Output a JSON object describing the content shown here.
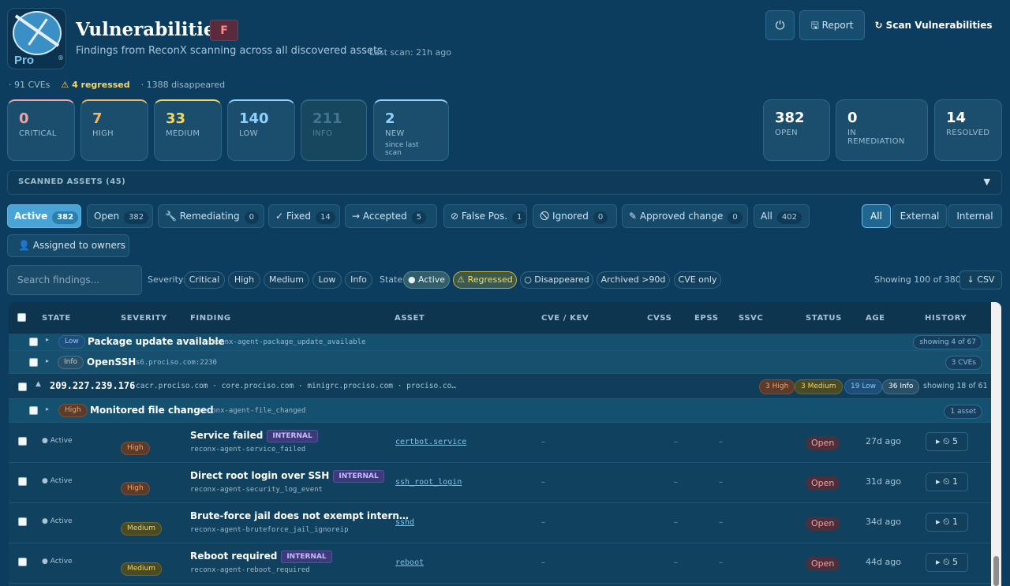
{
  "header": {
    "logo_text": "Pro CISO",
    "logo_sup": "®",
    "title": "Vulnerabilities",
    "grade": "F",
    "subtitle": "Findings from ReconX scanning across all discovered assets",
    "last_scan": "· Last scan: 21h ago",
    "power_icon": "⏻",
    "report_label": "🖫 Report",
    "scan_label": "↻ Scan Vulnerabilities"
  },
  "meta": {
    "cves": "· 91 CVEs",
    "regressed": "⚠ 4 regressed",
    "disappeared": "· 1388 disappeared"
  },
  "stats": [
    {
      "value": "0",
      "label": "CRITICAL",
      "color": "#f2a0a6"
    },
    {
      "value": "7",
      "label": "HIGH",
      "color": "#f2b66b"
    },
    {
      "value": "33",
      "label": "MEDIUM",
      "color": "#f0d868"
    },
    {
      "value": "140",
      "label": "LOW",
      "color": "#8fd0ff"
    },
    {
      "value": "211",
      "label": "INFO",
      "color": "#3f7692"
    },
    {
      "value": "2",
      "label": "NEW",
      "sub": "since last scan",
      "color": "#8fd0ff"
    }
  ],
  "stats_right": [
    {
      "value": "382",
      "label": "OPEN"
    },
    {
      "value": "0",
      "label": "IN REMEDIATION"
    },
    {
      "value": "14",
      "label": "RESOLVED"
    }
  ],
  "assets_bar": {
    "label": "SCANNED ASSETS (45)",
    "chevron": "▼"
  },
  "tabs": [
    {
      "label": "Active",
      "count": "382"
    },
    {
      "label": "Open",
      "count": "382"
    },
    {
      "label": "🔧 Remediating",
      "count": "0"
    },
    {
      "label": "✓ Fixed",
      "count": "14"
    },
    {
      "label": "→ Accepted",
      "count": "5"
    },
    {
      "label": "⊘ False Pos.",
      "count": "1"
    },
    {
      "label": "🛇 Ignored",
      "count": "0"
    },
    {
      "label": "✎ Approved change",
      "count": "0"
    },
    {
      "label": "All",
      "count": "402"
    }
  ],
  "scope": [
    "All",
    "External",
    "Internal"
  ],
  "assigned_label": "👤 Assigned to owners",
  "filters": {
    "search_placeholder": "Search findings...",
    "severity_label": "Severity:",
    "severity": [
      "Critical",
      "High",
      "Medium",
      "Low",
      "Info"
    ],
    "state_label": "State:",
    "states": [
      "● Active",
      "⚠ Regressed",
      "○ Disappeared",
      "Archived >90d",
      "CVE only"
    ],
    "showing": "Showing 100 of 380",
    "csv": "↓ CSV"
  },
  "table": {
    "columns": [
      "STATE",
      "SEVERITY",
      "FINDING",
      "ASSET",
      "CVE / KEV",
      "CVSS",
      "EPSS",
      "SSVC",
      "STATUS",
      "AGE",
      "HISTORY"
    ],
    "group1": {
      "sev": "Low",
      "name": "Package update available",
      "id": "reconx-agent-package_update_available",
      "badge": "showing 4 of 67"
    },
    "group2": {
      "sev": "Info",
      "name": "OpenSSH",
      "id": "s6.prociso.com:2230",
      "badge": "3 CVEs"
    },
    "host": {
      "ip": "209.227.239.176",
      "hosts": "cacr.prociso.com · core.prociso.com · minigrc.prociso.com · prociso.co…",
      "high": "3 High",
      "medium": "3 Medium",
      "low": "19 Low",
      "info": "36 Info",
      "showing": "showing 18 of 61"
    },
    "group3": {
      "sev": "High",
      "name": "Monitored file changed",
      "id": "reconx-agent-file_changed",
      "badge": "1 asset"
    },
    "rows": [
      {
        "state": "● Active",
        "sev": "High",
        "name": "Service failed",
        "tag": "INTERNAL",
        "id": "reconx-agent-service_failed",
        "asset": "certbot.service",
        "cve": "–",
        "cvss": "–",
        "epss": "–",
        "status": "Open",
        "age": "27d ago",
        "hist": "▸ ⏲ 5"
      },
      {
        "state": "● Active",
        "sev": "High",
        "name": "Direct root login over SSH",
        "tag": "INTERNAL",
        "id": "reconx-agent-security_log_event",
        "asset": "ssh_root_login",
        "cve": "–",
        "cvss": "–",
        "epss": "–",
        "status": "Open",
        "age": "31d ago",
        "hist": "▸ ⏲ 1"
      },
      {
        "state": "● Active",
        "sev": "Medium",
        "name": "Brute-force jail does not exempt intern…",
        "tag": "",
        "id": "reconx-agent-bruteforce_jail_ignoreip",
        "asset": "sshd",
        "cve": "–",
        "cvss": "–",
        "epss": "–",
        "status": "Open",
        "age": "34d ago",
        "hist": "▸ ⏲ 1"
      },
      {
        "state": "● Active",
        "sev": "Medium",
        "name": "Reboot required",
        "tag": "INTERNAL",
        "id": "reconx-agent-reboot_required",
        "asset": "reboot",
        "cve": "–",
        "cvss": "–",
        "epss": "–",
        "status": "Open",
        "age": "44d ago",
        "hist": "▸ ⏲ 5"
      }
    ]
  }
}
